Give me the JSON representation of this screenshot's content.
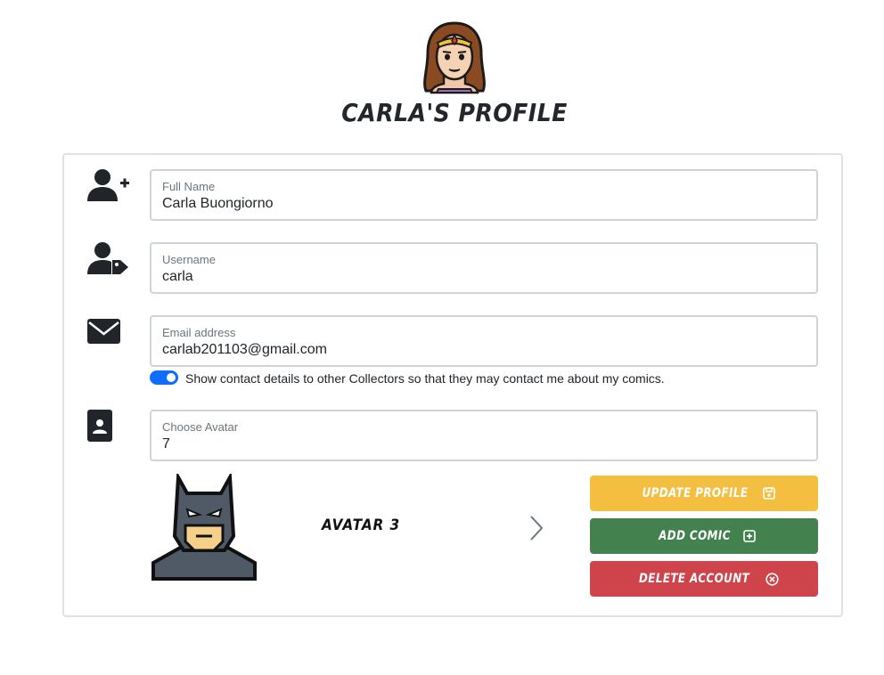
{
  "header": {
    "title": "Carla's Profile",
    "avatar_icon": "wonder-woman-avatar-icon"
  },
  "form": {
    "full_name": {
      "label": "Full Name",
      "value": "Carla Buongiorno",
      "icon": "user-plus-icon"
    },
    "username": {
      "label": "Username",
      "value": "carla",
      "icon": "user-tag-icon"
    },
    "email": {
      "label": "Email address",
      "value": "carlab201103@gmail.com",
      "icon": "envelope-icon"
    },
    "show_contact": {
      "label": "Show contact details to other Collectors so that they may contact me about my comics.",
      "checked": true
    },
    "avatar": {
      "label": "Choose Avatar",
      "value": "7",
      "icon": "contact-card-icon"
    }
  },
  "carousel": {
    "current_name": "Avatar 3",
    "current_icon": "batman-avatar-icon",
    "next_icon": "chevron-right-icon"
  },
  "buttons": {
    "update": {
      "label": "Update Profile",
      "icon": "save-icon",
      "color": "#f4bf40"
    },
    "add": {
      "label": "Add Comic",
      "icon": "plus-square-icon",
      "color": "#43824f"
    },
    "delete": {
      "label": "Delete Account",
      "icon": "x-circle-icon",
      "color": "#cf434a"
    }
  },
  "colors": {
    "switch_on": "#0d6efd",
    "border": "#ced4da"
  }
}
